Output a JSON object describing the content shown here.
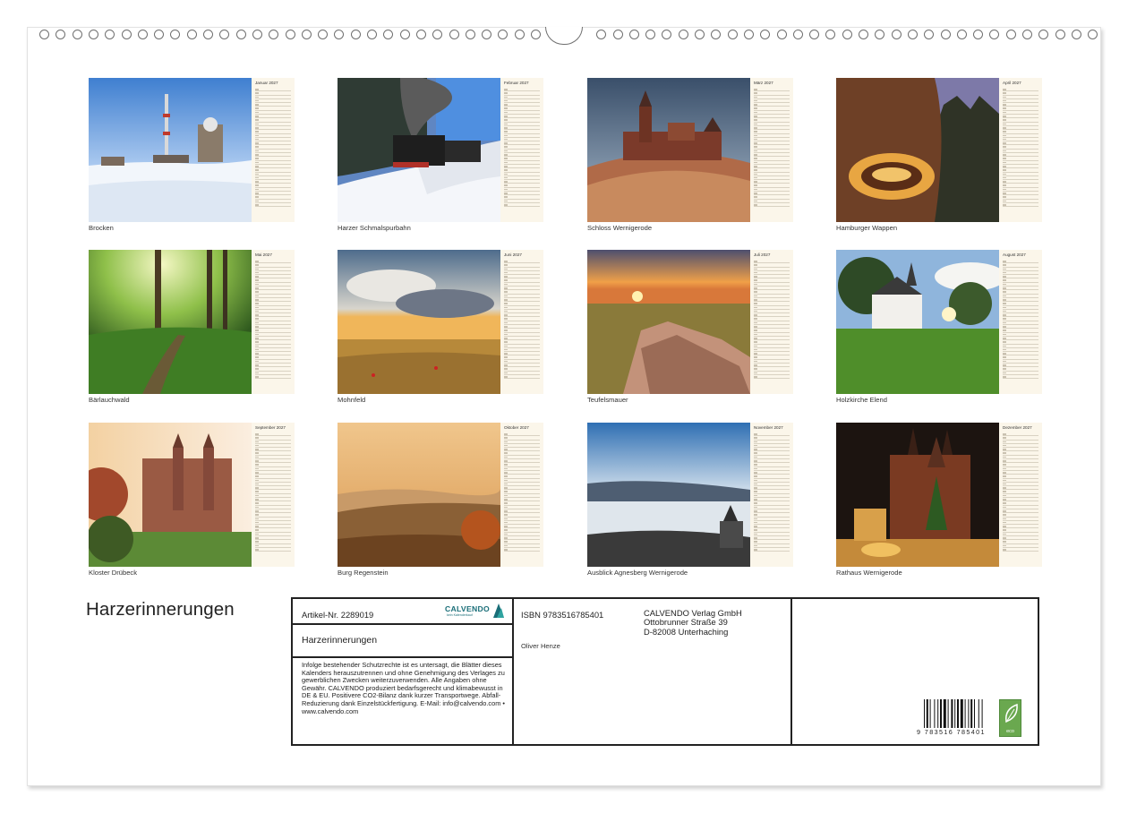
{
  "cover": {
    "title": "Harzerinnerungen"
  },
  "months": [
    {
      "month_label": "Januar 2027",
      "caption": "Brocken"
    },
    {
      "month_label": "Februar 2027",
      "caption": "Harzer Schmalspurbahn"
    },
    {
      "month_label": "März 2027",
      "caption": "Schloss Wernigerode"
    },
    {
      "month_label": "April 2027",
      "caption": "Hamburger Wappen"
    },
    {
      "month_label": "Mai 2027",
      "caption": "Bärlauchwald"
    },
    {
      "month_label": "Juni 2027",
      "caption": "Mohnfeld"
    },
    {
      "month_label": "Juli 2027",
      "caption": "Teufelsmauer"
    },
    {
      "month_label": "August 2027",
      "caption": "Holzkirche Elend"
    },
    {
      "month_label": "September 2027",
      "caption": "Kloster Drübeck"
    },
    {
      "month_label": "Oktober 2027",
      "caption": "Burg Regenstein"
    },
    {
      "month_label": "November 2027",
      "caption": "Ausblick Agnesberg Wernigerode"
    },
    {
      "month_label": "Dezember 2027",
      "caption": "Rathaus Wernigerode"
    }
  ],
  "info": {
    "article_no": "Artikel-Nr. 2289019",
    "logo": "CALVENDO",
    "logo_sub": "kein Kalenderkauf",
    "title": "Harzerinnerungen",
    "disclaimer": "Infolge bestehender Schutzrechte ist es untersagt, die Blätter dieses Kalenders herauszutrennen und ohne Genehmigung des Verlages zu gewerblichen Zwecken weiterzuverwenden. Alle Angaben ohne Gewähr. CALVENDO produziert bedarfsgerecht und klimabewusst in DE & EU. Positivere CO2-Bilanz dank kurzer Transportwege. Abfall-Reduzierung dank Einzelstückfertigung. E-Mail: info@calvendo.com • www.calvendo.com",
    "isbn": "ISBN 9783516785401",
    "author": "Oliver Henze",
    "publisher": [
      "CALVENDO Verlag GmbH",
      "Ottobrunner Straße 39",
      "D-82008 Unterhaching"
    ],
    "barcode_number": "9 783516 785401",
    "eco_label": "eco"
  },
  "colors": {
    "calendar_panel": "#fbf6ea",
    "border": "#222222",
    "brand": "#1a6e78",
    "eco": "#6aa84f"
  }
}
